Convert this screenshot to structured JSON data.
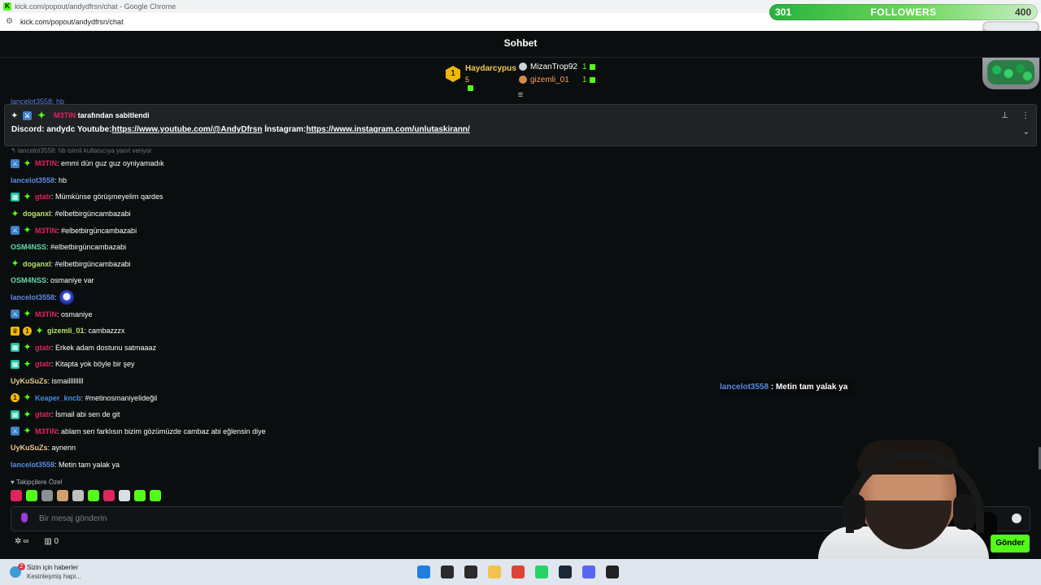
{
  "browser": {
    "window_title": "kick.com/popout/andydfrsn/chat - Google Chrome",
    "favicon_letter": "K",
    "url": "kick.com/popout/andydfrsn/chat"
  },
  "followers_widget": {
    "current": "301",
    "label": "FOLLOWERS",
    "goal": "400",
    "progress_fraction": 0.75
  },
  "chat": {
    "title": "Sohbet",
    "leaderboard": {
      "first": {
        "rank": "1",
        "name": "Haydarcypus",
        "count": "5"
      },
      "second": {
        "name": "MizanTrop92",
        "count": "1"
      },
      "third": {
        "name": "gizemli_01",
        "count": "1"
      }
    },
    "hidden_message": "lancelot3558: hb",
    "pinned": {
      "pinned_by_user": "M3TIN",
      "pinned_by_text": "tarafından sabitlendi",
      "body_prefix": "Discord: andydc Youtube:",
      "youtube_link": "https://www.youtube.com/@AndyDfrsn",
      "instagram_label": " İnstagram:",
      "instagram_link": "https://www.instagram.com/unlutaskirann/"
    },
    "reply_context": "lancelot3558: hb isimli kullanıcıya yanıt veriyor",
    "messages": [
      {
        "user": "M3TIN",
        "color": "#e0245e",
        "badges": [
          "mod",
          "sub"
        ],
        "text": ": emmi dün guz guz oyniyamadık"
      },
      {
        "user": "lancelot3558",
        "color": "#5b8ae6",
        "badges": [],
        "text": ": hb"
      },
      {
        "user": "gtatr",
        "color": "#e0245e",
        "badges": [
          "vip",
          "sub"
        ],
        "text": ": Mümkünse görüşmeyelim qardes"
      },
      {
        "user": "doganxl",
        "color": "#b7e36d",
        "badges": [
          "sub"
        ],
        "text": ": #elbetbirgüncambazabi"
      },
      {
        "user": "M3TIN",
        "color": "#e0245e",
        "badges": [
          "mod",
          "sub"
        ],
        "text": ": #elbetbirgüncambazabi"
      },
      {
        "user": "OSM4NSS",
        "color": "#68d6a8",
        "badges": [],
        "text": ": #elbetbirgüncambazabi"
      },
      {
        "user": "doganxl",
        "color": "#b7e36d",
        "badges": [
          "sub"
        ],
        "text": ": #elbetbirgüncambazabi"
      },
      {
        "user": "OSM4NSS",
        "color": "#68d6a8",
        "badges": [],
        "text": ": osmaniye var"
      },
      {
        "user": "lancelot3558",
        "color": "#5b8ae6",
        "badges": [],
        "text": ":",
        "emote": "chat-emote"
      },
      {
        "user": "M3TIN",
        "color": "#e0245e",
        "badges": [
          "mod",
          "sub"
        ],
        "text": ": osmaniye"
      },
      {
        "user": "gizemli_01",
        "color": "#b7e36d",
        "badges": [
          "crown",
          "og",
          "sub"
        ],
        "text": ": cambazzzx"
      },
      {
        "user": "gtatr",
        "color": "#e0245e",
        "badges": [
          "vip",
          "sub"
        ],
        "text": ": Erkek adam dostunu satmaaaz"
      },
      {
        "user": "gtatr",
        "color": "#e0245e",
        "badges": [
          "vip",
          "sub"
        ],
        "text": ": Kitapta yok böyle bir şey"
      },
      {
        "user": "UyKuSuZs",
        "color": "#e8c88a",
        "badges": [],
        "text": ": ismailllllllll"
      },
      {
        "user": "Keaper_kncb",
        "color": "#3f8de0",
        "badges": [
          "og",
          "sub"
        ],
        "text": ": #metinosmaniyelideğil"
      },
      {
        "user": "gtatr",
        "color": "#e0245e",
        "badges": [
          "vip",
          "sub"
        ],
        "text": ": İsmail abi sen de git"
      },
      {
        "user": "M3TIN",
        "color": "#e0245e",
        "badges": [
          "mod",
          "sub"
        ],
        "text": ": ablam sen farklısın bizim gözümüzde cambaz abi eğlensin diye"
      },
      {
        "user": "UyKuSuZs",
        "color": "#e8c88a",
        "badges": [],
        "text": ": aynenn"
      },
      {
        "user": "lancelot3558",
        "color": "#5b8ae6",
        "badges": [],
        "text": ": Metin tam yalak ya"
      }
    ],
    "overlay_message": {
      "user": "lancelot3558",
      "text": " : Metin tam yalak ya"
    },
    "followers_only": "Takipçilere Özel",
    "emote_bar": [
      "#e0245e",
      "#53fc18",
      "#8a8f93",
      "#d0a070",
      "#c0c0c0",
      "#53fc18",
      "#e0245e",
      "#d9e0e3",
      "#53fc18",
      "#53fc18"
    ],
    "input_placeholder": "Bir mesaj gönderin",
    "tools": {
      "infinity": "∞",
      "count": "0"
    },
    "send_label": "Gönder"
  },
  "taskbar": {
    "news_badge": "2",
    "news_title": "Sizin için haberler",
    "news_sub": "Kesinleşmiş hapi...",
    "apps": [
      "windows-start",
      "search",
      "task-view",
      "file-explorer",
      "chrome",
      "whatsapp",
      "steam",
      "discord",
      "obs"
    ]
  }
}
